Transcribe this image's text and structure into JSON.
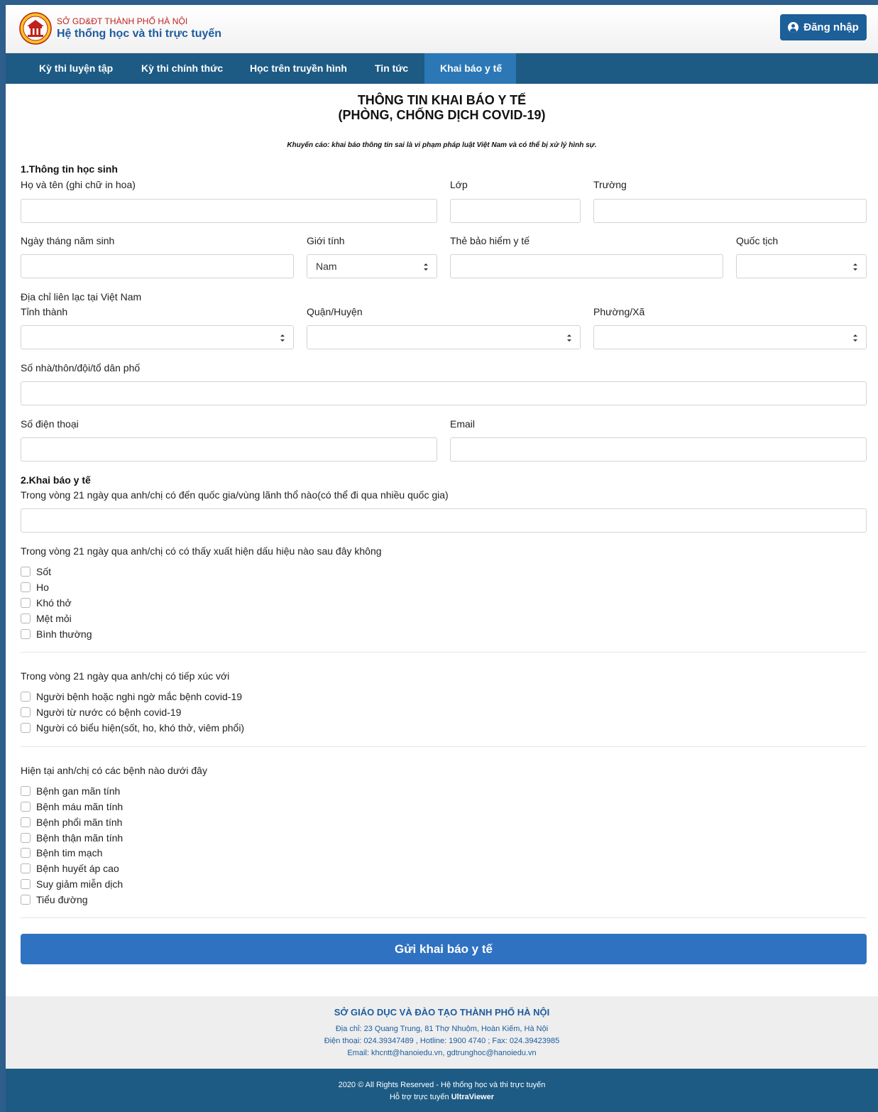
{
  "header": {
    "org_name": "SỞ GD&ĐT THÀNH PHỐ HÀ NỘI",
    "system_name": "Hệ thống học và thi trực tuyến",
    "login_label": "Đăng nhập"
  },
  "nav": {
    "items": [
      "Kỳ thi luyện tập",
      "Kỳ thi chính thức",
      "Học trên truyền hình",
      "Tin tức",
      "Khai báo y tế"
    ],
    "active": "Khai báo y tế"
  },
  "page": {
    "title_line1": "THÔNG TIN KHAI BÁO Y TẾ",
    "title_line2": "(PHÒNG, CHỐNG DỊCH COVID-19)",
    "warning": "Khuyến cáo: khai báo thông tin sai là vi phạm pháp luật Việt Nam và có thể bị xử lý hình sự."
  },
  "section1": {
    "title": "1.Thông tin học sinh",
    "full_name_label": "Họ và tên (ghi chữ in hoa)",
    "full_name_value": "",
    "class_label": "Lớp",
    "class_value": "",
    "school_label": "Trường",
    "school_value": "",
    "dob_label": "Ngày tháng năm sinh",
    "dob_value": "",
    "gender_label": "Giới tính",
    "gender_value": "Nam",
    "insurance_label": "Thẻ bảo hiểm y tế",
    "insurance_value": "",
    "nationality_label": "Quốc tịch",
    "nationality_value": "",
    "address_label": "Địa chỉ liên lạc tại Việt Nam",
    "province_label": "Tỉnh thành",
    "province_value": "",
    "district_label": "Quận/Huyện",
    "district_value": "",
    "ward_label": "Phường/Xã",
    "ward_value": "",
    "street_label": "Số nhà/thôn/đội/tổ dân phố",
    "street_value": "",
    "phone_label": "Số điện thoại",
    "phone_value": "",
    "email_label": "Email",
    "email_value": ""
  },
  "section2": {
    "title": "2.Khai báo y tế",
    "travel_question": "Trong vòng 21 ngày qua anh/chị có đến quốc gia/vùng lãnh thổ nào(có thể đi qua nhiều quốc gia)",
    "travel_value": "",
    "symptoms_question": "Trong vòng 21 ngày qua anh/chị có có thấy xuất hiện dấu hiệu nào sau đây không",
    "symptoms": [
      "Sốt",
      "Ho",
      "Khó thở",
      "Mệt mỏi",
      "Bình thường"
    ],
    "contact_question": "Trong vòng 21 ngày qua anh/chị có tiếp xúc với",
    "contacts": [
      "Người bệnh hoặc nghi ngờ mắc bệnh covid-19",
      "Người từ nước có bệnh covid-19",
      "Người có biểu hiện(sốt, ho, khó thở, viêm phổi)"
    ],
    "diseases_question": "Hiện tại anh/chị có các bệnh nào dưới đây",
    "diseases": [
      "Bệnh gan mãn tính",
      "Bệnh máu mãn tính",
      "Bệnh phổi mãn tính",
      "Bệnh thận mãn tính",
      "Bệnh tim mạch",
      "Bệnh huyết áp cao",
      "Suy giảm miễn dịch",
      "Tiểu đường"
    ]
  },
  "submit_label": "Gửi khai báo y tế",
  "footer": {
    "org": "SỞ GIÁO DỤC VÀ ĐÀO TẠO THÀNH PHỐ HÀ NỘI",
    "address": "Địa chỉ: 23 Quang Trung, 81 Thợ Nhuộm, Hoàn Kiếm, Hà Nội",
    "phone": "Điện thoại: 024.39347489 , Hotline: 1900 4740 ; Fax: 024.39423985",
    "email": "Email: khcntt@hanoiedu.vn, gdtrunghoc@hanoiedu.vn",
    "copyright": "2020 © All Rights Reserved - Hệ thống học và thi trực tuyến",
    "support_prefix": "Hỗ trợ trực tuyến",
    "support_tool": "UltraViewer"
  },
  "colors": {
    "brand_blue": "#1c5c9f",
    "nav_bg": "#1d5b84",
    "nav_active": "#2c78b6",
    "submit_bg": "#2f72c2",
    "brand_red": "#c0221d"
  },
  "icons": [
    "school-logo-icon",
    "user-circle-icon",
    "select-arrows-icon"
  ]
}
